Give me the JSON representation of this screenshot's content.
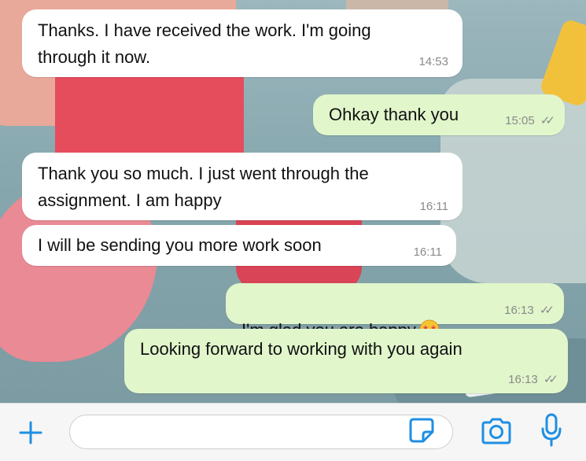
{
  "colors": {
    "incoming_bubble": "#ffffff",
    "outgoing_bubble": "#e1f6cb",
    "accent": "#1f8fe3",
    "timestamp": "#8a8a8a"
  },
  "messages": [
    {
      "direction": "incoming",
      "text": "Thanks. I have received the work. I'm going\nthrough it now.",
      "time": "14:53"
    },
    {
      "direction": "outgoing",
      "text": "Ohkay thank you",
      "time": "15:05",
      "status": "read"
    },
    {
      "direction": "incoming",
      "text": "Thank you so much. I just went through the\nassignment. I am happy",
      "time": "16:11"
    },
    {
      "direction": "incoming",
      "text": "I will be sending you more work soon",
      "time": "16:11"
    },
    {
      "direction": "outgoing",
      "text": "I'm glad you are happy",
      "emoji": "star-struck-emoji",
      "time": "16:13",
      "status": "read"
    },
    {
      "direction": "outgoing",
      "text": "Looking forward to working with you again",
      "time": "16:13",
      "status": "read"
    }
  ],
  "composer": {
    "placeholder": "",
    "value": "",
    "icons": [
      "plus-icon",
      "sticker-icon",
      "camera-icon",
      "microphone-icon"
    ]
  }
}
